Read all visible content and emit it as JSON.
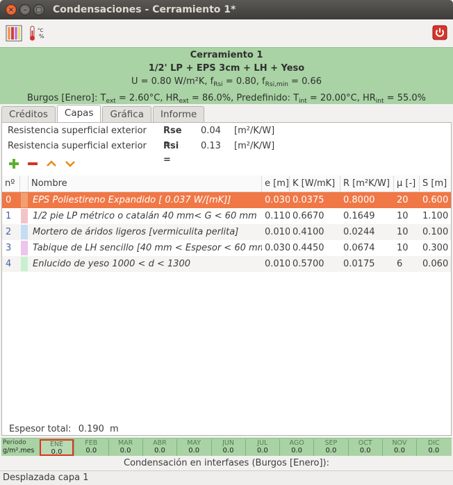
{
  "window": {
    "title": "Condensaciones - Cerramiento 1*"
  },
  "toolbar": {
    "chart_icon": "colored-bars-icon",
    "thermo_icon": "thermometer-icon",
    "thermo_text_c": "°C",
    "thermo_text_p": "%",
    "power_icon": "power-icon"
  },
  "header": {
    "name": "Cerramiento 1",
    "composition": "1/2' LP + EPS 3cm + LH + Yeso",
    "u": "U = 0.80 W/m²K, f",
    "f_sub": "Rsi",
    "f_val": " = 0.80, f",
    "fmin_sub": "Rsi,min",
    "fmin_val": " = 0.66",
    "climate_a": "Burgos [Enero]: T",
    "climate_tsub": "ext",
    "climate_b": " = 2.60°C, HR",
    "climate_hrsub": "ext",
    "climate_c": " = 86.0%, Predefinido: T",
    "climate_tisub": "int",
    "climate_d": " = 20.00°C, HR",
    "climate_hrisub": "int",
    "climate_e": " = 55.0%"
  },
  "tabs": [
    "Créditos",
    "Capas",
    "Gráfica",
    "Informe"
  ],
  "active_tab": "Capas",
  "resistances": [
    {
      "label": "Resistencia superficial exterior",
      "key": "Rse =",
      "value": "0.04",
      "unit": "[m²/K/W]"
    },
    {
      "label": "Resistencia superficial exterior",
      "key": "Rsi =",
      "value": "0.13",
      "unit": "[m²/K/W]"
    }
  ],
  "actions": {
    "add_icon": "plus-icon",
    "remove_icon": "minus-icon",
    "up_icon": "chevron-up-icon",
    "down_icon": "chevron-down-icon"
  },
  "table": {
    "headers": [
      "nº",
      "Nombre",
      "e [m]",
      "K [W/mK]",
      "R [m²K/W]",
      "μ [-]",
      "S [m]"
    ],
    "rows": [
      {
        "n": "0",
        "color": "#f0a070",
        "name": "EPS Poliestireno Expandido [ 0.037 W/[mK]]",
        "e": "0.030",
        "k": "0.0375",
        "r": "0.8000",
        "mu": "20",
        "s": "0.600"
      },
      {
        "n": "1",
        "color": "#f4c3c8",
        "name": "1/2 pie LP métrico o catalán 40 mm< G < 60 mm",
        "e": "0.110",
        "k": "0.6670",
        "r": "0.1649",
        "mu": "10",
        "s": "1.100"
      },
      {
        "n": "2",
        "color": "#c4dcf4",
        "name": "Mortero de áridos ligeros [vermiculita perlita]",
        "e": "0.010",
        "k": "0.4100",
        "r": "0.0244",
        "mu": "10",
        "s": "0.100"
      },
      {
        "n": "3",
        "color": "#ecc4ee",
        "name": "Tabique de LH sencillo [40 mm < Espesor < 60 mm]",
        "e": "0.030",
        "k": "0.4450",
        "r": "0.0674",
        "mu": "10",
        "s": "0.300"
      },
      {
        "n": "4",
        "color": "#c8f0d0",
        "name": "Enlucido de yeso 1000 < d < 1300",
        "e": "0.010",
        "k": "0.5700",
        "r": "0.0175",
        "mu": "6",
        "s": "0.060"
      }
    ]
  },
  "espesor": {
    "label": "Espesor total:",
    "value": "0.190",
    "unit": "m"
  },
  "period": {
    "label1": "Periodo",
    "label2": "g/m².mes",
    "months": [
      {
        "name": "ENE",
        "value": "0.0"
      },
      {
        "name": "FEB",
        "value": "0.0"
      },
      {
        "name": "MAR",
        "value": "0.0"
      },
      {
        "name": "ABR",
        "value": "0.0"
      },
      {
        "name": "MAY",
        "value": "0.0"
      },
      {
        "name": "JUN",
        "value": "0.0"
      },
      {
        "name": "JUL",
        "value": "0.0"
      },
      {
        "name": "AGO",
        "value": "0.0"
      },
      {
        "name": "SEP",
        "value": "0.0"
      },
      {
        "name": "OCT",
        "value": "0.0"
      },
      {
        "name": "NOV",
        "value": "0.0"
      },
      {
        "name": "DIC",
        "value": "0.0"
      }
    ],
    "active": "ENE"
  },
  "condensation_text": "Condensación en interfases (Burgos [Enero]):",
  "status": "Desplazada capa 1"
}
